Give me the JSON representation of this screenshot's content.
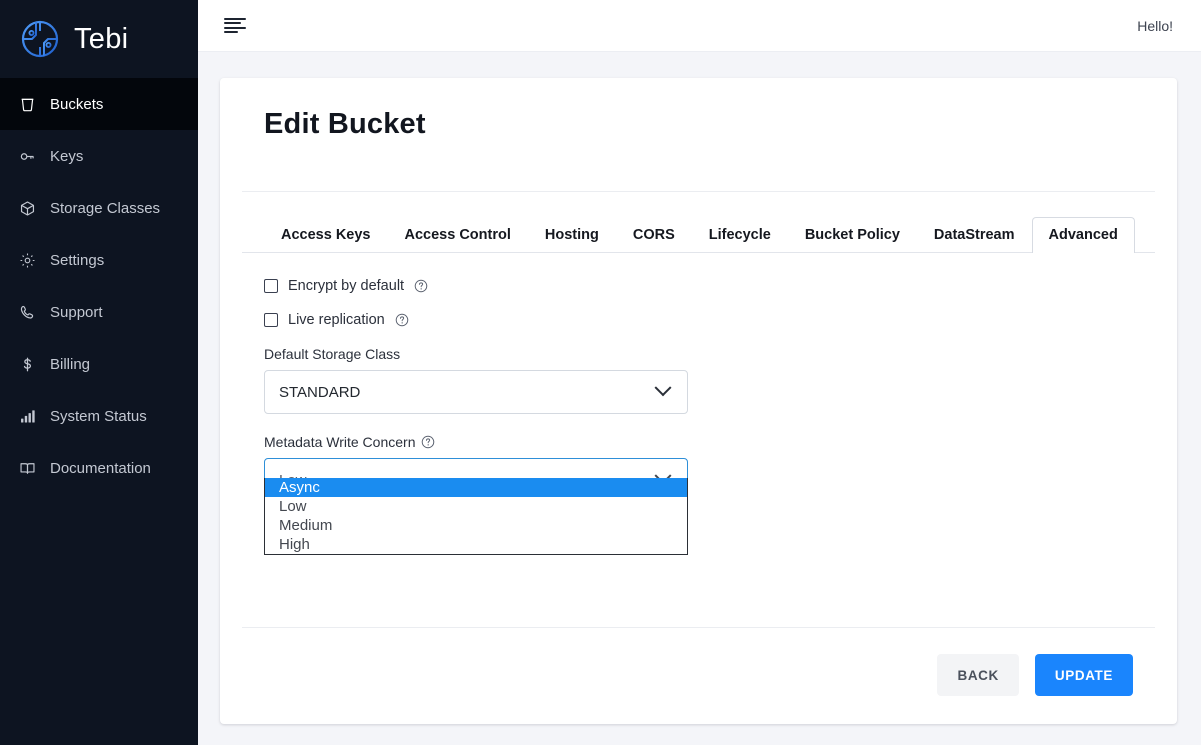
{
  "brand": {
    "name": "Tebi",
    "logo_icon": "tebi-circuit-circle-logo"
  },
  "sidebar": {
    "items": [
      {
        "label": "Buckets",
        "icon": "bucket-icon",
        "active": true
      },
      {
        "label": "Keys",
        "icon": "key-icon",
        "active": false
      },
      {
        "label": "Storage Classes",
        "icon": "cube-icon",
        "active": false
      },
      {
        "label": "Settings",
        "icon": "gear-icon",
        "active": false
      },
      {
        "label": "Support",
        "icon": "phone-icon",
        "active": false
      },
      {
        "label": "Billing",
        "icon": "dollar-icon",
        "active": false
      },
      {
        "label": "System Status",
        "icon": "bar-chart-icon",
        "active": false
      },
      {
        "label": "Documentation",
        "icon": "book-icon",
        "active": false
      }
    ]
  },
  "topbar": {
    "menu_toggle_icon": "hamburger-icon",
    "greeting": "Hello!"
  },
  "page": {
    "title": "Edit Bucket",
    "subtitle": ""
  },
  "tabs": [
    {
      "label": "Access Keys",
      "active": false
    },
    {
      "label": "Access Control",
      "active": false
    },
    {
      "label": "Hosting",
      "active": false
    },
    {
      "label": "CORS",
      "active": false
    },
    {
      "label": "Lifecycle",
      "active": false
    },
    {
      "label": "Bucket Policy",
      "active": false
    },
    {
      "label": "DataStream",
      "active": false
    },
    {
      "label": "Advanced",
      "active": true
    }
  ],
  "form": {
    "encrypt_by_default": {
      "label": "Encrypt by default",
      "checked": false,
      "help_icon": "question-circle-icon"
    },
    "live_replication": {
      "label": "Live replication",
      "checked": false,
      "help_icon": "question-circle-icon"
    },
    "default_storage_class": {
      "label": "Default Storage Class",
      "value": "STANDARD",
      "caret_icon": "chevron-down-icon"
    },
    "metadata_write_concern": {
      "label": "Metadata Write Concern",
      "help_icon": "question-circle-icon",
      "value": "Low",
      "caret_icon": "chevron-down-icon",
      "open": true,
      "highlighted": "Async",
      "options": [
        "Async",
        "Low",
        "Medium",
        "High"
      ]
    }
  },
  "actions": {
    "back_label": "BACK",
    "update_label": "UPDATE"
  },
  "colors": {
    "sidebar_bg": "#0d1421",
    "sidebar_active_bg": "#03060c",
    "accent_blue": "#1a85fd",
    "option_highlight": "#1a8cf0",
    "page_bg": "#f4f5f9",
    "focus_border": "#2e8fd8"
  }
}
